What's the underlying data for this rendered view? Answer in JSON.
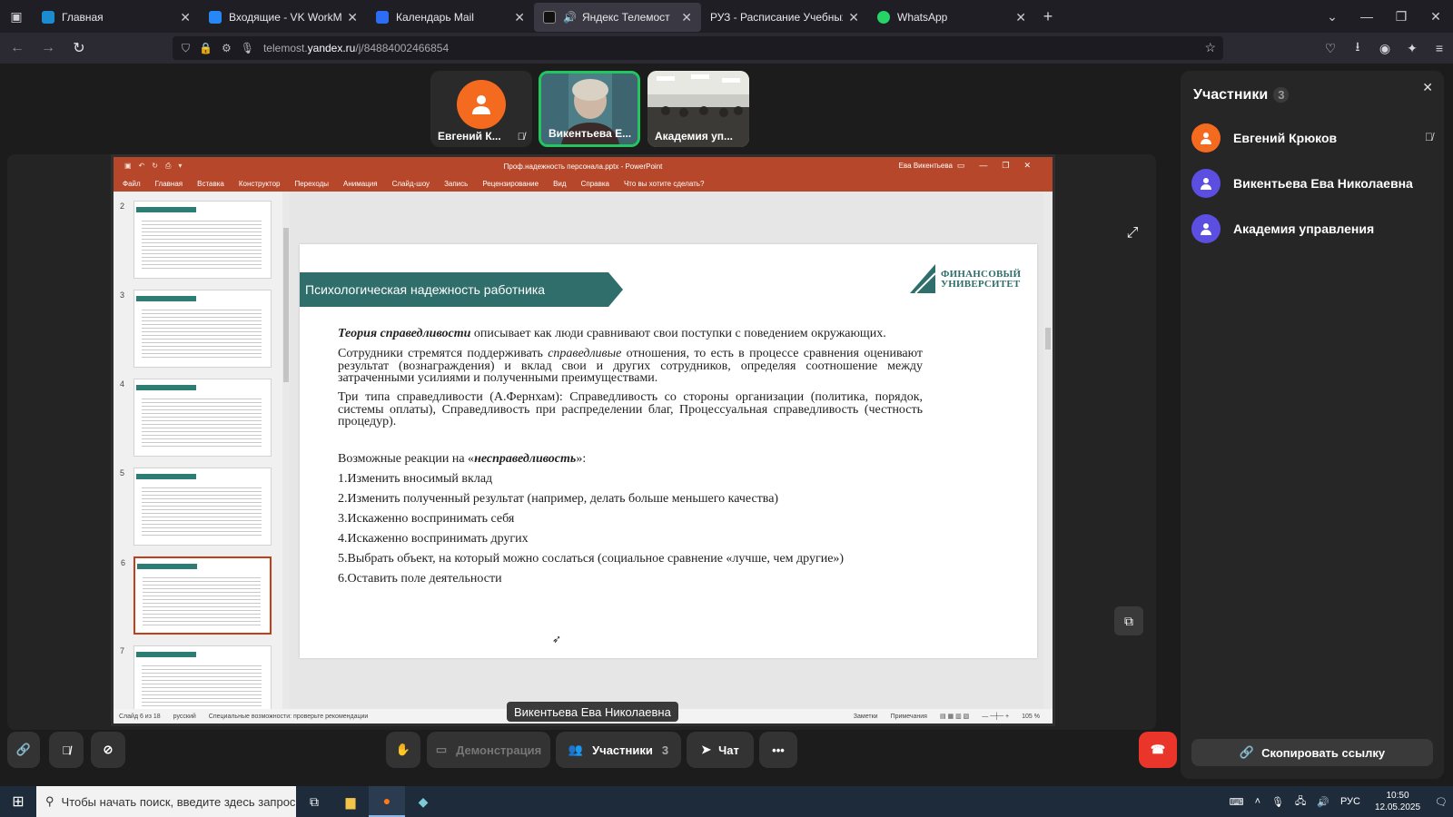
{
  "browser": {
    "tabs": [
      {
        "title": "Главная",
        "color": "#1a8ccf"
      },
      {
        "title": "Входящие - VK WorkMail",
        "color": "#2787f5"
      },
      {
        "title": "Календарь Mail",
        "color": "#2d6df6"
      },
      {
        "title": "Яндекс Телемост",
        "color": "#ffffff"
      },
      {
        "title": "РУЗ - Расписание Учебных Заняти",
        "color": "#333333"
      },
      {
        "title": "WhatsApp",
        "color": "#25d366"
      }
    ],
    "url_host": "telemost.",
    "url_main": "yandex.ru",
    "url_path": "/j/84884002466854"
  },
  "tiles": [
    {
      "name": "Евгений К...",
      "muted": true
    },
    {
      "name": "Викентьева Е...",
      "muted": false
    },
    {
      "name": "Академия уп...",
      "muted": false
    }
  ],
  "ppt": {
    "doc_title": "Проф.надежность персонала.pptx - PowerPoint",
    "user": "Ева Викентьева",
    "ribbon": [
      "Файл",
      "Главная",
      "Вставка",
      "Конструктор",
      "Переходы",
      "Анимация",
      "Слайд-шоу",
      "Запись",
      "Рецензирование",
      "Вид",
      "Справка",
      "Что вы хотите сделать?"
    ],
    "thumb_numbers": [
      "2",
      "3",
      "4",
      "5",
      "6",
      "7"
    ],
    "status": {
      "slide": "Слайд 6 из 18",
      "lang": "русский",
      "access": "Специальные возможности: проверьте рекомендации",
      "notes": "Заметки",
      "comments": "Примечания",
      "zoom": "105 %"
    }
  },
  "slide": {
    "banner": "Психологическая надежность работника",
    "logo_line1": "ФИНАНСОВЫЙ",
    "logo_line2": "УНИВЕРСИТЕТ",
    "p1_em": "Теория справедливости",
    "p1_rest": " описывает как люди сравнивают свои поступки с поведением окружающих.",
    "p2a": "Сотрудники стремятся поддерживать ",
    "p2_em": "справедливые",
    "p2b": " отношения, то есть в процессе сравнения оценивают результат (вознаграждения) и вклад свои и других сотрудников, определяя соотношение между затраченными усилиями и полученными преимуществами.",
    "p3": "Три типа справедливости (А.Фернхам): Справедливость со стороны организации (политика, порядок, системы оплаты), Справедливость при распределении благ, Процессуальная справедливость (честность процедур).",
    "reactions_a": "Возможные реакции на «",
    "reactions_em": "несправедливость",
    "reactions_b": "»:",
    "items": [
      "1.Изменить вносимый вклад",
      "2.Изменить полученный результат (например, делать больше меньшего качества)",
      "3.Искаженно воспринимать себя",
      "4.Искаженно воспринимать других",
      "5.Выбрать объект, на который можно сослаться (социальное сравнение «лучше, чем другие»)",
      "6.Оставить поле деятельности"
    ]
  },
  "speaker_label": "Викентьева Ева Николаевна",
  "controls": {
    "demo": "Демонстрация",
    "participants": "Участники",
    "participants_count": "3",
    "chat": "Чат"
  },
  "panel": {
    "title": "Участники",
    "count": "3",
    "people": [
      {
        "name": "Евгений Крюков",
        "color": "#f46b1f",
        "muted": true
      },
      {
        "name": "Викентьева Ева Николаевна",
        "color": "#5b4ee0",
        "muted": false
      },
      {
        "name": "Академия управления",
        "color": "#5b4ee0",
        "muted": false
      }
    ],
    "copy_link": "Скопировать ссылку"
  },
  "taskbar": {
    "search_placeholder": "Чтобы начать поиск, введите здесь запрос",
    "lang": "РУС",
    "time": "10:50",
    "date": "12.05.2025"
  }
}
